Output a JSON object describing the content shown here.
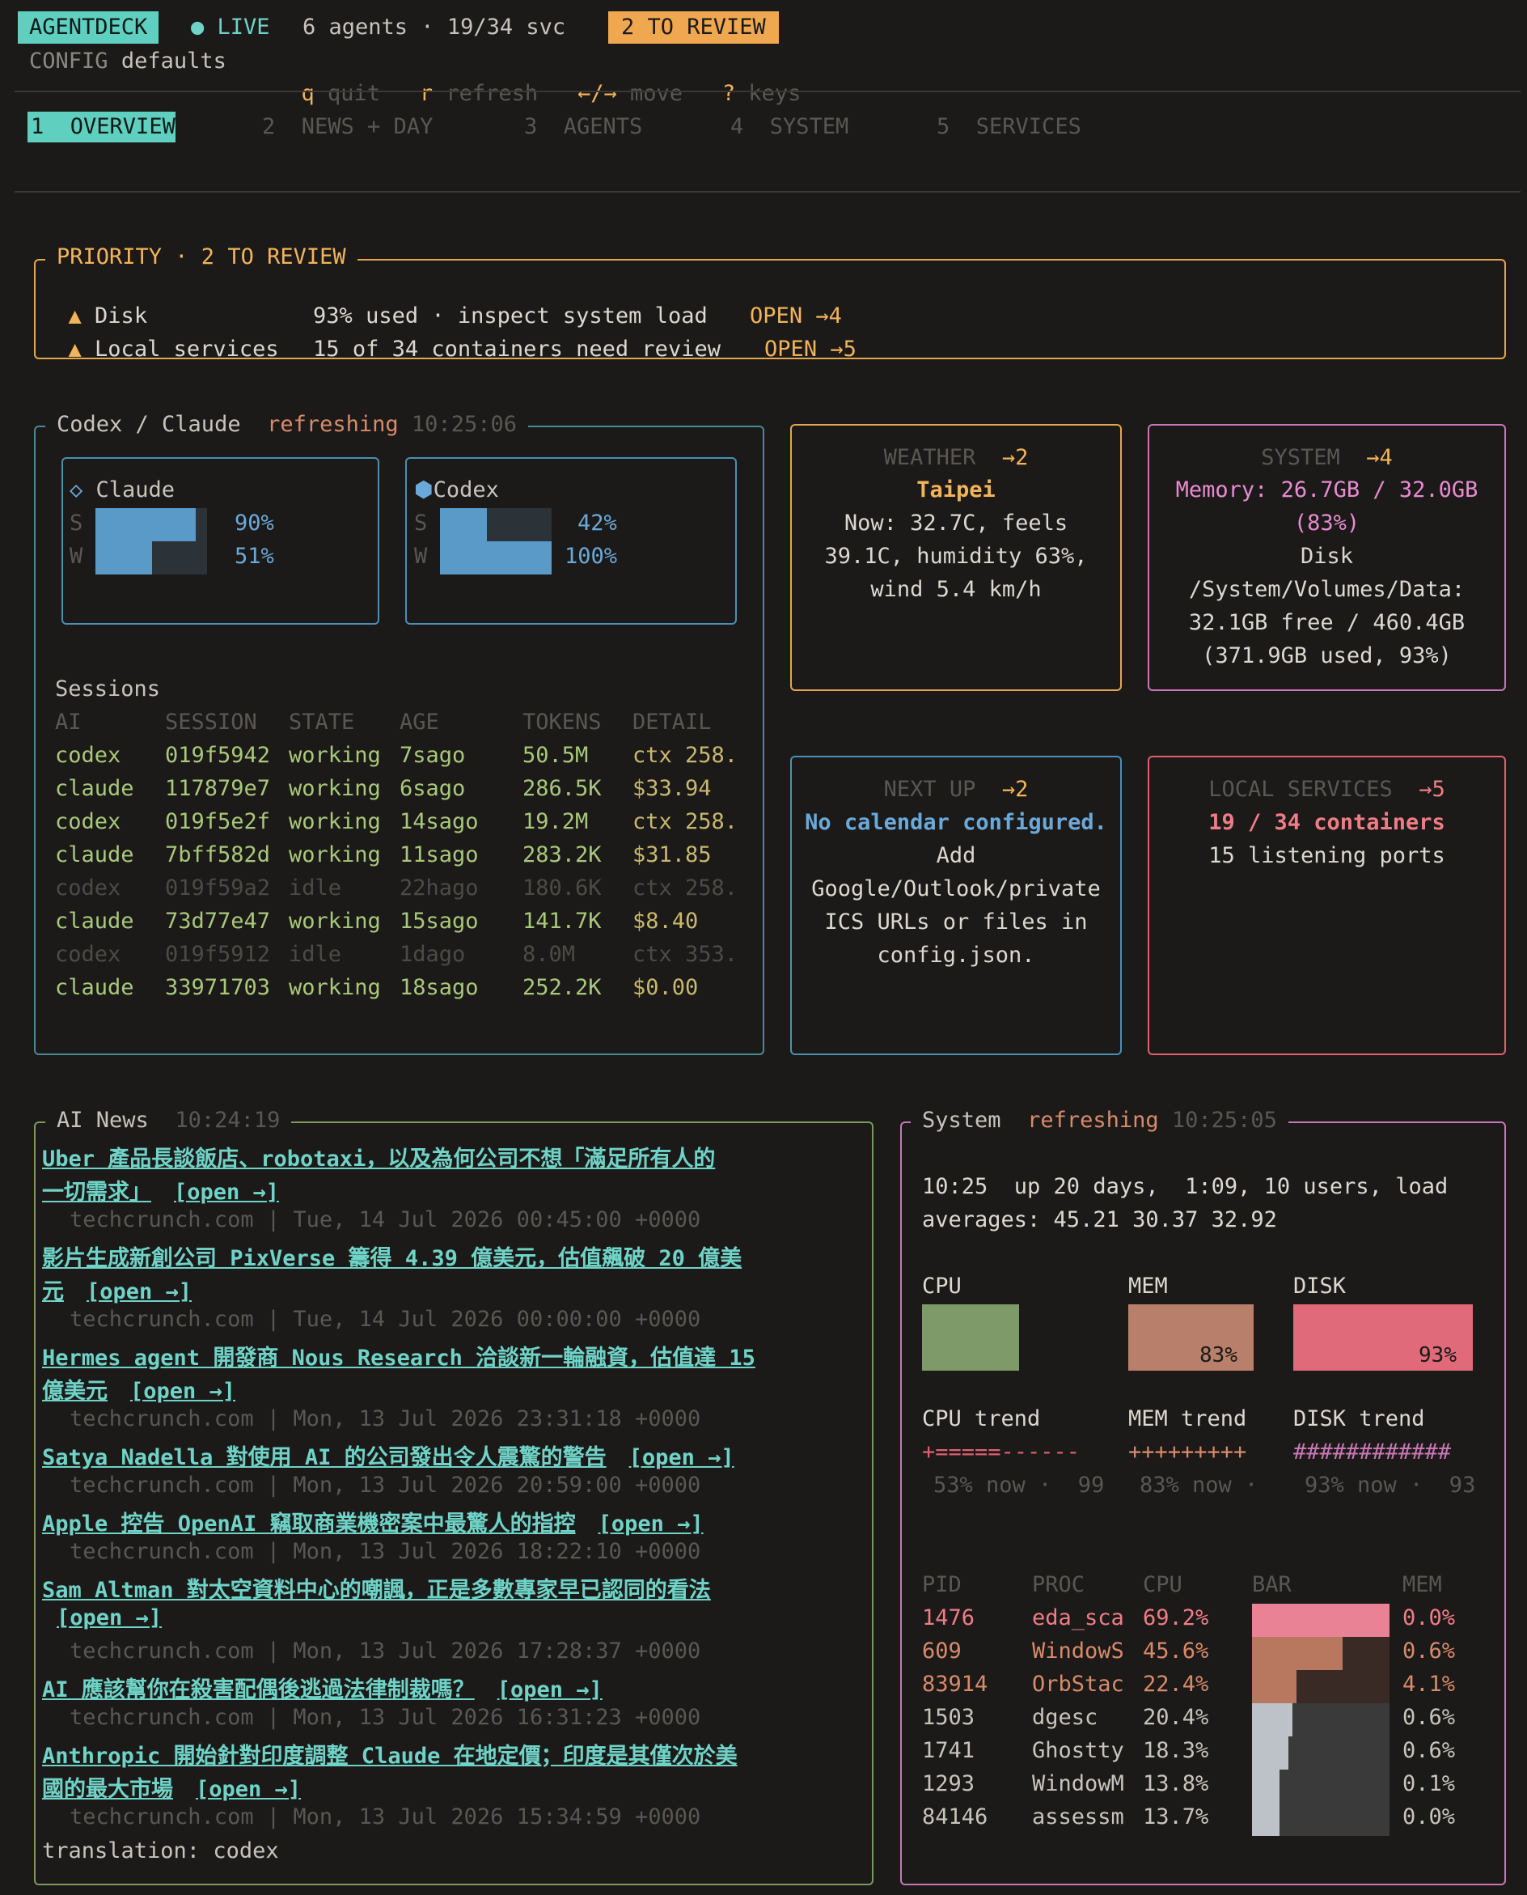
{
  "header": {
    "app": "AGENTDECK",
    "live": "LIVE",
    "agents": "6 agents",
    "svc": "19/34 svc",
    "review_badge": "2 TO REVIEW",
    "config_label": "CONFIG",
    "config_value": "defaults",
    "keys": [
      {
        "key": "q",
        "label": "quit"
      },
      {
        "key": "r",
        "label": "refresh"
      },
      {
        "key": "←/→",
        "label": "move"
      },
      {
        "key": "?",
        "label": "keys"
      }
    ]
  },
  "tabs": [
    {
      "num": "1",
      "label": "OVERVIEW",
      "active": true
    },
    {
      "num": "2",
      "label": "NEWS + DAY"
    },
    {
      "num": "3",
      "label": "AGENTS"
    },
    {
      "num": "4",
      "label": "SYSTEM"
    },
    {
      "num": "5",
      "label": "SERVICES"
    }
  ],
  "priority": {
    "title": "PRIORITY · 2 TO REVIEW",
    "items": [
      {
        "icon": "▲",
        "name": "Disk",
        "detail": "93% used · inspect system load",
        "action": "OPEN →4"
      },
      {
        "icon": "▲",
        "name": "Local services",
        "detail": "15 of 34 containers need review",
        "action": "OPEN →5"
      }
    ]
  },
  "agents_panel": {
    "title": "Codex / Claude",
    "status": "refreshing",
    "time": "10:25:06",
    "claude": {
      "icon": "◇",
      "name": "Claude",
      "s_label": "S",
      "w_label": "W",
      "s_pct": "90%",
      "w_pct": "51%",
      "s": 0.9,
      "w": 0.51
    },
    "codex": {
      "icon": "⬢",
      "name": "Codex",
      "s_label": "S",
      "w_label": "W",
      "s_pct": "42%",
      "w_pct": "100%",
      "s": 0.42,
      "w": 1.0
    },
    "sessions_title": "Sessions",
    "columns": [
      "AI",
      "SESSION",
      "STATE",
      "AGE",
      "TOKENS",
      "DETAIL"
    ],
    "rows": [
      [
        "codex",
        "019f5942",
        "working",
        "7sago",
        "50.5M",
        "ctx 258."
      ],
      [
        "claude",
        "117879e7",
        "working",
        "6sago",
        "286.5K",
        "$33.94"
      ],
      [
        "codex",
        "019f5e2f",
        "working",
        "14sago",
        "19.2M",
        "ctx 258."
      ],
      [
        "claude",
        "7bff582d",
        "working",
        "11sago",
        "283.2K",
        "$31.85"
      ],
      [
        "codex",
        "019f59a2",
        "idle",
        "22hago",
        "180.6K",
        "ctx 258."
      ],
      [
        "claude",
        "73d77e47",
        "working",
        "15sago",
        "141.7K",
        "$8.40"
      ],
      [
        "codex",
        "019f5912",
        "idle",
        "1dago",
        "8.0M",
        "ctx 353."
      ],
      [
        "claude",
        "33971703",
        "working",
        "18sago",
        "252.2K",
        "$0.00"
      ]
    ]
  },
  "weather": {
    "title": "WEATHER",
    "jump": "→2",
    "city": "Taipei",
    "lines": [
      "Now: 32.7C, feels",
      "39.1C, humidity 63%,",
      "wind 5.4 km/h"
    ]
  },
  "system_card": {
    "title": "SYSTEM",
    "jump": "→4",
    "mem_lines": [
      "Memory: 26.7GB / 32.0GB",
      "(83%)"
    ],
    "lines": [
      "Disk",
      "/System/Volumes/Data:",
      "32.1GB free / 460.4GB",
      "(371.9GB used, 93%)"
    ]
  },
  "next_up": {
    "title": "NEXT UP",
    "jump": "→2",
    "headline": "No calendar configured.",
    "lines": [
      "Add",
      "Google/Outlook/private",
      "ICS URLs or files in",
      "config.json."
    ]
  },
  "local_services": {
    "title": "LOCAL SERVICES",
    "jump": "→5",
    "headline": "19 / 34 containers",
    "line": "15 listening ports"
  },
  "news": {
    "title": "AI News",
    "time": "10:24:19",
    "open_label": "[open →]",
    "items": [
      {
        "lines": [
          "Uber 產品長談飯店、robotaxi，以及為何公司不想「滿足所有人的",
          "一切需求」"
        ],
        "src": "techcrunch.com | Tue, 14 Jul 2026 00:45:00 +0000"
      },
      {
        "lines": [
          "影片生成新創公司 PixVerse 籌得 4.39 億美元，估值飆破 20 億美",
          "元"
        ],
        "src": "techcrunch.com | Tue, 14 Jul 2026 00:00:00 +0000"
      },
      {
        "lines": [
          "Hermes agent 開發商 Nous Research 洽談新一輪融資，估值達 15",
          "億美元"
        ],
        "src": "techcrunch.com | Mon, 13 Jul 2026 23:31:18 +0000"
      },
      {
        "lines": [
          "Satya Nadella 對使用 AI 的公司發出令人震驚的警告"
        ],
        "src": "techcrunch.com | Mon, 13 Jul 2026 20:59:00 +0000"
      },
      {
        "lines": [
          "Apple 控告 OpenAI 竊取商業機密案中最驚人的指控"
        ],
        "src": "techcrunch.com | Mon, 13 Jul 2026 18:22:10 +0000"
      },
      {
        "lines": [
          "Sam Altman 對太空資料中心的嘲諷，正是多數專家早已認同的看法",
          ""
        ],
        "src": "techcrunch.com | Mon, 13 Jul 2026 17:28:37 +0000"
      },
      {
        "lines": [
          "AI 應該幫你在殺害配偶後逃過法律制裁嗎？"
        ],
        "src": "techcrunch.com | Mon, 13 Jul 2026 16:31:23 +0000"
      },
      {
        "lines": [
          "Anthropic 開始針對印度調整 Claude 在地定價；印度是其僅次於美",
          "國的最大市場"
        ],
        "src": "techcrunch.com | Mon, 13 Jul 2026 15:34:59 +0000"
      }
    ],
    "footer": "translation: codex"
  },
  "system_panel": {
    "title": "System",
    "status": "refreshing",
    "time": "10:25:05",
    "uptime_lines": [
      "10:25  up 20 days,  1:09, 10 users, load",
      "averages: 45.21 30.37 32.92"
    ],
    "gauges": [
      {
        "label": "CPU",
        "pct": "53%",
        "value": 0.53,
        "color": "#7e9a68"
      },
      {
        "label": "MEM",
        "pct": "83%",
        "value": 0.83,
        "color": "#b8806a"
      },
      {
        "label": "DISK",
        "pct": "93%",
        "value": 0.93,
        "color": "#e06a7a"
      }
    ],
    "trends": [
      {
        "label": "CPU trend",
        "spark": "+=====------",
        "caption": "53% now ·  99"
      },
      {
        "label": "MEM trend",
        "spark": "+++++++++",
        "caption": "83% now ·"
      },
      {
        "label": "DISK trend",
        "spark": "############",
        "caption": "93% now ·  93"
      }
    ],
    "proc_columns": [
      "PID",
      "PROC",
      "CPU",
      "BAR",
      "MEM"
    ],
    "procs": [
      {
        "pid": "1476",
        "proc": "eda_sca",
        "cpu": "69.2%",
        "mem": "0.0%",
        "cpu_v": 69.2,
        "hot": "red"
      },
      {
        "pid": "609",
        "proc": "WindowS",
        "cpu": "45.6%",
        "mem": "0.6%",
        "cpu_v": 45.6,
        "hot": "orange"
      },
      {
        "pid": "83914",
        "proc": "OrbStac",
        "cpu": "22.4%",
        "mem": "4.1%",
        "cpu_v": 22.4,
        "hot": "orange"
      },
      {
        "pid": "1503",
        "proc": "dgesc",
        "cpu": "20.4%",
        "mem": "0.6%",
        "cpu_v": 20.4,
        "hot": "none"
      },
      {
        "pid": "1741",
        "proc": "Ghostty",
        "cpu": "18.3%",
        "mem": "0.6%",
        "cpu_v": 18.3,
        "hot": "none"
      },
      {
        "pid": "1293",
        "proc": "WindowM",
        "cpu": "13.8%",
        "mem": "0.1%",
        "cpu_v": 13.8,
        "hot": "none"
      },
      {
        "pid": "84146",
        "proc": "assessm",
        "cpu": "13.7%",
        "mem": "0.0%",
        "cpu_v": 13.7,
        "hot": "none"
      }
    ]
  }
}
